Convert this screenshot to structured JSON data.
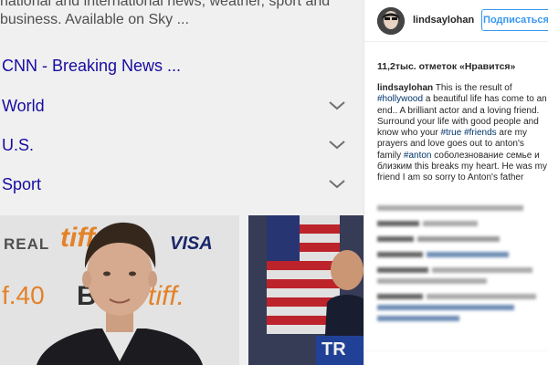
{
  "search": {
    "snippet_lines": [
      "national and international news, weather, sport and",
      "business. Available on Sky ..."
    ],
    "result_title": "CNN - Breaking News ...",
    "sections": [
      {
        "label": "World"
      },
      {
        "label": "U.S."
      },
      {
        "label": "Sport"
      }
    ],
    "photo_logos": {
      "real": "REAL",
      "tiff": "tiff",
      "visa": "VISA",
      "forty": "f.40",
      "b": "B",
      "tiff2": "tiff."
    },
    "banner_text": "TR"
  },
  "instagram": {
    "username": "lindsaylohan",
    "follow_label": "Подписаться",
    "likes": "11,2тыс. отметок «Нравится»",
    "caption": {
      "author": "lindsaylohan",
      "t1": " This is the result of ",
      "tag1": "#hollywood",
      "t2": " a beautiful life has come to an end.. A brilliant actor and a loving friend. Surround your life with good people and know who your ",
      "tag2": "#true",
      "t3": " ",
      "tag3": "#friends",
      "t4": " are my prayers and love goes out to anton's family ",
      "tag4": "#anton",
      "t5": " соболезнование семье и близким this breaks my heart. He was my friend I am so sorry to Anton's father"
    }
  },
  "colors": {
    "link": "#1a0dab",
    "follow": "#3897f0",
    "hashtag": "#003569"
  }
}
